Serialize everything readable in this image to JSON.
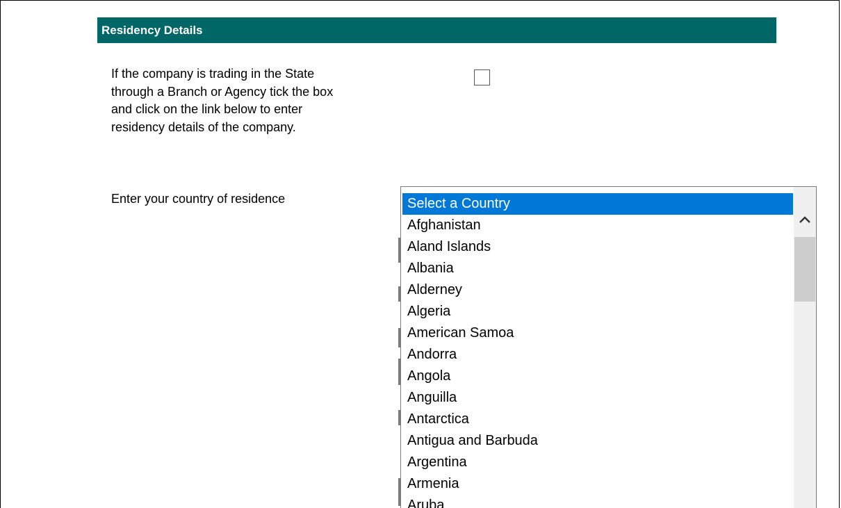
{
  "section": {
    "title": "Residency Details"
  },
  "branch_question": {
    "lines": [
      "If the company is trading in the State",
      "through a Branch or Agency tick the box",
      "and click on the link below to enter",
      "residency details of the company."
    ],
    "checkbox_checked": false
  },
  "country": {
    "label": "Enter your country of residence",
    "options": [
      "Select a Country",
      "Afghanistan",
      "Aland Islands",
      "Albania",
      "Alderney",
      "Algeria",
      "American Samoa",
      "Andorra",
      "Angola",
      "Anguilla",
      "Antarctica",
      "Antigua and Barbuda",
      "Argentina",
      "Armenia",
      "Aruba"
    ],
    "selected": "Select a Country"
  },
  "colors": {
    "header_bg": "#006666",
    "selection_bg": "#0078d7"
  },
  "icons": {
    "scroll_up": "chevron-up-icon"
  }
}
